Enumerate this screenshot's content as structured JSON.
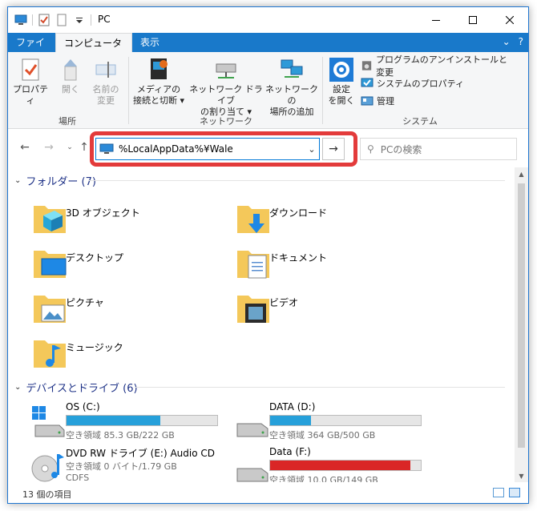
{
  "window": {
    "title": "PC"
  },
  "tabs": {
    "file": "ファイル",
    "computer": "コンピューター",
    "view": "表示"
  },
  "ribbon": {
    "location": {
      "label": "場所",
      "properties": "プロパティ",
      "open": "開く",
      "rename_line1": "名前の",
      "rename_line2": "変更"
    },
    "network": {
      "label": "ネットワーク",
      "media_line1": "メディアの",
      "media_line2": "接続と切断 ▾",
      "map_line1": "ネットワーク ドライブ",
      "map_line2": "の割り当て ▾",
      "add_line1": "ネットワークの",
      "add_line2": "場所の追加"
    },
    "system": {
      "label": "システム",
      "settings_line1": "設定",
      "settings_line2": "を開く",
      "uninstall": "プログラムのアンインストールと変更",
      "sysprops": "システムのプロパティ",
      "manage": "管理"
    }
  },
  "address": {
    "value": "%LocalAppData%¥Wale"
  },
  "search": {
    "placeholder": "PCの検索"
  },
  "folders": {
    "header": "フォルダー (7)",
    "items": [
      {
        "name": "3D オブジェクト"
      },
      {
        "name": "ダウンロード"
      },
      {
        "name": "デスクトップ"
      },
      {
        "name": "ドキュメント"
      },
      {
        "name": "ピクチャ"
      },
      {
        "name": "ビデオ"
      },
      {
        "name": "ミュージック"
      }
    ]
  },
  "drives": {
    "header": "デバイスとドライブ (6)",
    "items": [
      {
        "name": "OS (C:)",
        "free": "空き領域 85.3 GB/222 GB",
        "used_fraction": 0.62
      },
      {
        "name": "DATA (D:)",
        "free": "空き領域 364 GB/500 GB",
        "used_fraction": 0.27
      },
      {
        "name": "DVD RW ドライブ (E:) Audio CD",
        "line2": "空き領域 0 バイト/1.79 GB",
        "line3": "CDFS"
      },
      {
        "name": "Data (F:)",
        "free": "空き領域 10.0 GB/149 GB",
        "used_fraction": 0.93
      }
    ]
  },
  "status": {
    "count": "13 個の項目"
  },
  "colors": {
    "accent": "#1979ca",
    "bar_normal": "#26a0da",
    "bar_full": "#da2626",
    "highlight": "#e33b3b"
  }
}
